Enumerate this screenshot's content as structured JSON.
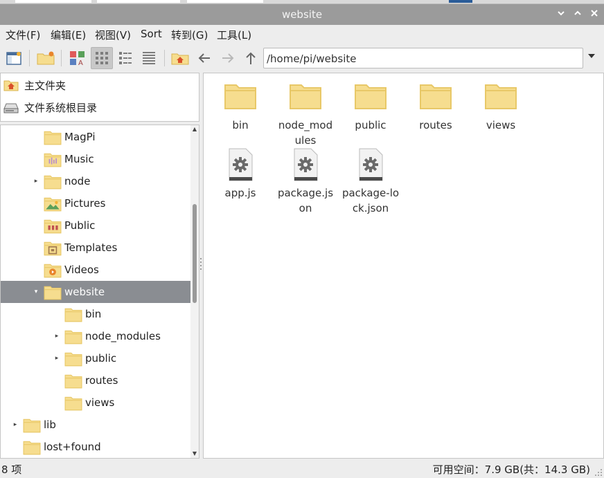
{
  "window": {
    "title": "website"
  },
  "menu": [
    {
      "label": "文件(F)"
    },
    {
      "label": "编辑(E)"
    },
    {
      "label": "视图(V)"
    },
    {
      "label": "Sort"
    },
    {
      "label": "转到(G)"
    },
    {
      "label": "工具(L)"
    }
  ],
  "address": {
    "path": "/home/pi/website"
  },
  "places": [
    {
      "label": "主文件夹",
      "icon": "home-icon"
    },
    {
      "label": "文件系统根目录",
      "icon": "drive-icon"
    }
  ],
  "tree": [
    {
      "label": "MagPi",
      "icon": "folder",
      "depth": 2,
      "expander": ""
    },
    {
      "label": "Music",
      "icon": "music-folder",
      "depth": 2,
      "expander": ""
    },
    {
      "label": "node",
      "icon": "folder",
      "depth": 2,
      "expander": "collapsed"
    },
    {
      "label": "Pictures",
      "icon": "pictures-folder",
      "depth": 2,
      "expander": ""
    },
    {
      "label": "Public",
      "icon": "public-folder",
      "depth": 2,
      "expander": ""
    },
    {
      "label": "Templates",
      "icon": "templates-folder",
      "depth": 2,
      "expander": ""
    },
    {
      "label": "Videos",
      "icon": "videos-folder",
      "depth": 2,
      "expander": ""
    },
    {
      "label": "website",
      "icon": "folder",
      "depth": 2,
      "expander": "expanded",
      "selected": true
    },
    {
      "label": "bin",
      "icon": "folder",
      "depth": 3,
      "expander": ""
    },
    {
      "label": "node_modules",
      "icon": "folder",
      "depth": 3,
      "expander": "collapsed"
    },
    {
      "label": "public",
      "icon": "folder",
      "depth": 3,
      "expander": "collapsed"
    },
    {
      "label": "routes",
      "icon": "folder",
      "depth": 3,
      "expander": ""
    },
    {
      "label": "views",
      "icon": "folder",
      "depth": 3,
      "expander": ""
    },
    {
      "label": "lib",
      "icon": "folder",
      "depth": 1,
      "expander": "collapsed"
    },
    {
      "label": "lost+found",
      "icon": "folder",
      "depth": 1,
      "expander": ""
    }
  ],
  "files": [
    {
      "name": "bin",
      "type": "folder"
    },
    {
      "name": "node_modules",
      "type": "folder"
    },
    {
      "name": "public",
      "type": "folder"
    },
    {
      "name": "routes",
      "type": "folder"
    },
    {
      "name": "views",
      "type": "folder"
    },
    {
      "name": "app.js",
      "type": "file"
    },
    {
      "name": "package.json",
      "type": "file"
    },
    {
      "name": "package-lock.json",
      "type": "file"
    }
  ],
  "status": {
    "count": "8 项",
    "free_space": "可用空间：7.9 GB(共：14.3 GB)"
  },
  "colors": {
    "folder": "#f6dd8f",
    "folder_dark": "#e8c868",
    "selection": "#8a8d92",
    "titlebar": "#9b9b9b"
  }
}
